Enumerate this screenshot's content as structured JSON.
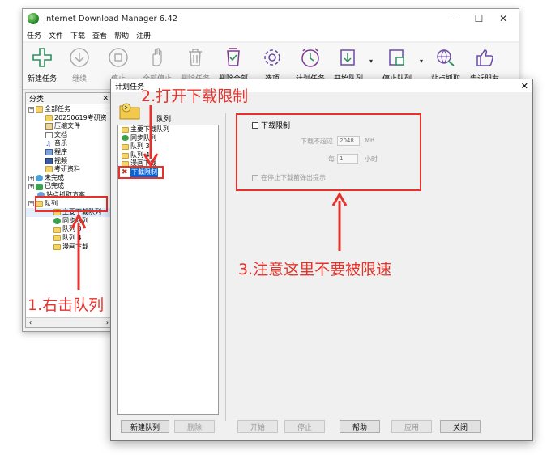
{
  "window": {
    "title": "Internet Download Manager 6.42",
    "controls": [
      "—",
      "☐",
      "✕"
    ]
  },
  "menu": [
    "任务",
    "文件",
    "下载",
    "查看",
    "帮助",
    "注册"
  ],
  "toolbar": [
    {
      "label": "新建任务",
      "icon": "plus-icon",
      "enabled": true
    },
    {
      "label": "继续",
      "icon": "download-circle-icon",
      "enabled": false
    },
    {
      "label": "停止",
      "icon": "stop-icon",
      "enabled": false
    },
    {
      "label": "全部停止",
      "icon": "hand-icon",
      "enabled": false
    },
    {
      "label": "删除任务",
      "icon": "trash-icon",
      "enabled": false
    },
    {
      "label": "删除全部",
      "icon": "delete-all-icon",
      "enabled": true
    },
    {
      "label": "选项",
      "icon": "gear-icon",
      "enabled": true
    },
    {
      "label": "计划任务",
      "icon": "clock-icon",
      "enabled": true
    },
    {
      "label": "开始队列",
      "icon": "start-queue-icon",
      "enabled": true
    },
    {
      "label": "停止队列",
      "icon": "stop-queue-icon",
      "enabled": true
    },
    {
      "label": "站点抓取",
      "icon": "site-grab-icon",
      "enabled": true
    },
    {
      "label": "告诉朋友",
      "icon": "thumbs-up-icon",
      "enabled": true
    }
  ],
  "categories": {
    "header": "分类",
    "close": "✕",
    "items": [
      {
        "label": "全部任务",
        "kind": "folder"
      },
      {
        "label": "20250619考研资",
        "kind": "folder"
      },
      {
        "label": "压缩文件",
        "kind": "zip"
      },
      {
        "label": "文档",
        "kind": "doc"
      },
      {
        "label": "音乐",
        "kind": "music"
      },
      {
        "label": "程序",
        "kind": "program"
      },
      {
        "label": "视频",
        "kind": "video"
      },
      {
        "label": "考研资料",
        "kind": "folder"
      },
      {
        "label": "未完成",
        "kind": "unfinished"
      },
      {
        "label": "已完成",
        "kind": "finished"
      },
      {
        "label": "站点抓取方案",
        "kind": "site"
      },
      {
        "label": "队列",
        "kind": "folder"
      },
      {
        "label": "主要下载队列",
        "kind": "folder"
      },
      {
        "label": "同步队列",
        "kind": "sync"
      },
      {
        "label": "队列 3",
        "kind": "folder"
      },
      {
        "label": "队列 4",
        "kind": "folder"
      },
      {
        "label": "漫画下载",
        "kind": "folder"
      }
    ],
    "scroll_left": "‹",
    "scroll_right": "›"
  },
  "dialog": {
    "title": "计划任务",
    "close": "✕",
    "queue_heading": "队列",
    "queues": [
      {
        "label": "主要下载队列",
        "kind": "folder",
        "selected": false
      },
      {
        "label": "同步队列",
        "kind": "sync",
        "selected": false
      },
      {
        "label": "队列 3",
        "kind": "folder",
        "selected": false
      },
      {
        "label": "队列 4",
        "kind": "folder",
        "selected": false
      },
      {
        "label": "漫画下载",
        "kind": "folder",
        "selected": false
      },
      {
        "label": "下载限制",
        "kind": "limit",
        "selected": true
      }
    ],
    "limit": {
      "checkbox_label": "下载限制",
      "max_label": "下载不超过",
      "max_value": "2048",
      "max_unit": "MB",
      "per_label": "每",
      "per_value": "1",
      "per_unit": "小时",
      "warn_label": "在停止下载前弹出提示"
    },
    "buttons": [
      {
        "label": "新建队列",
        "enabled": true
      },
      {
        "label": "删除",
        "enabled": false
      },
      {
        "label": "开始",
        "enabled": false
      },
      {
        "label": "停止",
        "enabled": false
      },
      {
        "label": "帮助",
        "enabled": true
      },
      {
        "label": "应用",
        "enabled": false
      },
      {
        "label": "关闭",
        "enabled": true
      }
    ]
  },
  "annotations": {
    "step1": "1.右击队列",
    "step2": "2.打开下载限制",
    "step3": "3.注意这里不要被限速",
    "color": "#e8312b"
  }
}
